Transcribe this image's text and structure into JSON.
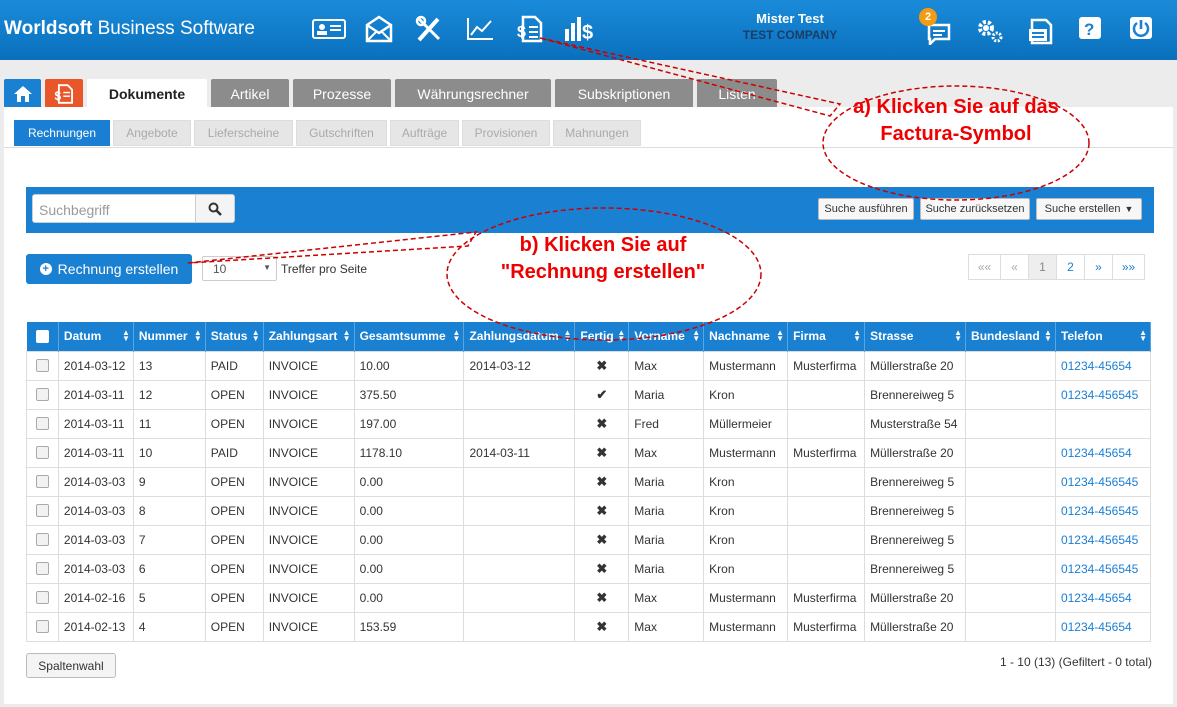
{
  "header": {
    "brand_bold": "Worldsoft",
    "brand_rest": " Business Software",
    "user_name": "Mister Test",
    "company": "TEST COMPANY",
    "notification_count": "2",
    "icons": [
      "contact-card-icon",
      "mail-icon",
      "tools-icon",
      "chart-icon",
      "factura-icon",
      "sales-icon",
      "chat-icon",
      "settings-icon",
      "documents-icon",
      "help-icon",
      "power-icon"
    ]
  },
  "main_tabs": [
    "Dokumente",
    "Artikel",
    "Prozesse",
    "Währungsrechner",
    "Subskriptionen",
    "Listen"
  ],
  "sub_tabs": [
    "Rechnungen",
    "Angebote",
    "Lieferscheine",
    "Gutschriften",
    "Aufträge",
    "Provisionen",
    "Mahnungen"
  ],
  "search": {
    "placeholder": "Suchbegriff",
    "execute": "Suche ausführen",
    "reset": "Suche zurücksetzen",
    "create": "Suche erstellen"
  },
  "actions": {
    "create_invoice": "Rechnung erstellen",
    "per_page_value": "10",
    "per_page_label": "Treffer pro Seite"
  },
  "pager": [
    "««",
    "«",
    "1",
    "2",
    "»",
    "»»"
  ],
  "table": {
    "columns": [
      "Datum",
      "Nummer",
      "Status",
      "Zahlungsart",
      "Gesamtsumme",
      "Zahlungsdatum",
      "Fertig",
      "Vorname",
      "Nachname",
      "Firma",
      "Strasse",
      "Bundesland",
      "Telefon"
    ],
    "rows": [
      [
        "2014-03-12",
        "13",
        "PAID",
        "INVOICE",
        "10.00",
        "2014-03-12",
        "✖",
        "Max",
        "Mustermann",
        "Musterfirma",
        "Müllerstraße 20",
        "",
        "01234-45654"
      ],
      [
        "2014-03-11",
        "12",
        "OPEN",
        "INVOICE",
        "375.50",
        "",
        "✔",
        "Maria",
        "Kron",
        "",
        "Brennereiweg 5",
        "",
        "01234-456545"
      ],
      [
        "2014-03-11",
        "11",
        "OPEN",
        "INVOICE",
        "197.00",
        "",
        "✖",
        "Fred",
        "Müllermeier",
        "",
        "Musterstraße 54",
        "",
        ""
      ],
      [
        "2014-03-11",
        "10",
        "PAID",
        "INVOICE",
        "1178.10",
        "2014-03-11",
        "✖",
        "Max",
        "Mustermann",
        "Musterfirma",
        "Müllerstraße 20",
        "",
        "01234-45654"
      ],
      [
        "2014-03-03",
        "9",
        "OPEN",
        "INVOICE",
        "0.00",
        "",
        "✖",
        "Maria",
        "Kron",
        "",
        "Brennereiweg 5",
        "",
        "01234-456545"
      ],
      [
        "2014-03-03",
        "8",
        "OPEN",
        "INVOICE",
        "0.00",
        "",
        "✖",
        "Maria",
        "Kron",
        "",
        "Brennereiweg 5",
        "",
        "01234-456545"
      ],
      [
        "2014-03-03",
        "7",
        "OPEN",
        "INVOICE",
        "0.00",
        "",
        "✖",
        "Maria",
        "Kron",
        "",
        "Brennereiweg 5",
        "",
        "01234-456545"
      ],
      [
        "2014-03-03",
        "6",
        "OPEN",
        "INVOICE",
        "0.00",
        "",
        "✖",
        "Maria",
        "Kron",
        "",
        "Brennereiweg 5",
        "",
        "01234-456545"
      ],
      [
        "2014-02-16",
        "5",
        "OPEN",
        "INVOICE",
        "0.00",
        "",
        "✖",
        "Max",
        "Mustermann",
        "Musterfirma",
        "Müllerstraße 20",
        "",
        "01234-45654"
      ],
      [
        "2014-02-13",
        "4",
        "OPEN",
        "INVOICE",
        "153.59",
        "",
        "✖",
        "Max",
        "Mustermann",
        "Musterfirma",
        "Müllerstraße 20",
        "",
        "01234-45654"
      ]
    ]
  },
  "footer": {
    "column_select": "Spaltenwahl",
    "summary": "1 - 10 (13) (Gefiltert - 0 total)"
  },
  "annotations": {
    "a": "a) Klicken Sie auf das Factura-Symbol",
    "b": "b) Klicken Sie auf \"Rechnung erstellen\""
  },
  "colors": {
    "primary": "#1a80d2",
    "annotation": "#e00000",
    "badge": "#f39c12"
  }
}
